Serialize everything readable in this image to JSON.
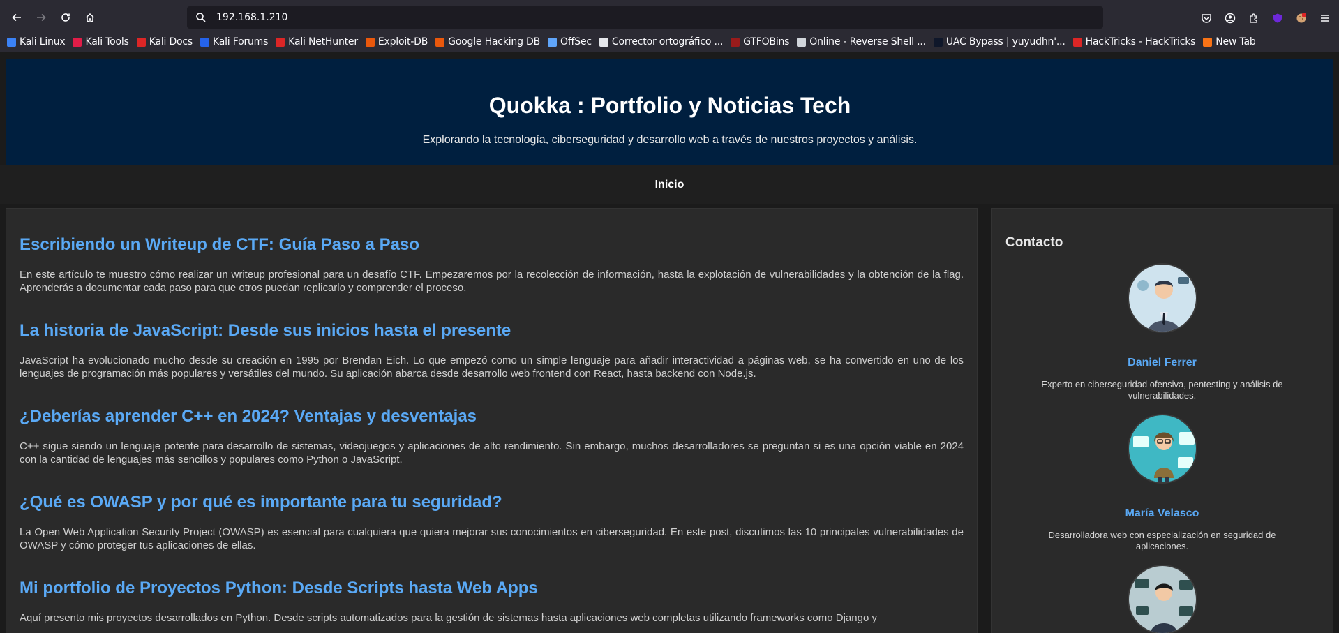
{
  "browser": {
    "url": "192.168.1.210",
    "bookmarks": [
      {
        "label": "Kali Linux",
        "color": "#3b82f6"
      },
      {
        "label": "Kali Tools",
        "color": "#e11d48"
      },
      {
        "label": "Kali Docs",
        "color": "#dc2626"
      },
      {
        "label": "Kali Forums",
        "color": "#2563eb"
      },
      {
        "label": "Kali NetHunter",
        "color": "#dc2626"
      },
      {
        "label": "Exploit-DB",
        "color": "#ea580c"
      },
      {
        "label": "Google Hacking DB",
        "color": "#ea580c"
      },
      {
        "label": "OffSec",
        "color": "#60a5fa"
      },
      {
        "label": "Corrector ortográfico ...",
        "color": "#e5e7eb"
      },
      {
        "label": "GTFOBins",
        "color": "#991b1b"
      },
      {
        "label": "Online - Reverse Shell ...",
        "color": "#d1d5db"
      },
      {
        "label": "UAC Bypass | yuyudhn'...",
        "color": "#0f172a"
      },
      {
        "label": "HackTricks - HackTricks",
        "color": "#dc2626"
      },
      {
        "label": "New Tab",
        "color": "#f97316"
      }
    ]
  },
  "site": {
    "title": "Quokka : Portfolio y Noticias Tech",
    "subtitle": "Explorando la tecnología, ciberseguridad y desarrollo web a través de nuestros proyectos y análisis.",
    "nav_home": "Inicio"
  },
  "posts": [
    {
      "title": "Escribiendo un Writeup de CTF: Guía Paso a Paso",
      "body": "En este artículo te muestro cómo realizar un writeup profesional para un desafío CTF. Empezaremos por la recolección de información, hasta la explotación de vulnerabilidades y la obtención de la flag. Aprenderás a documentar cada paso para que otros puedan replicarlo y comprender el proceso."
    },
    {
      "title": "La historia de JavaScript: Desde sus inicios hasta el presente",
      "body": "JavaScript ha evolucionado mucho desde su creación en 1995 por Brendan Eich. Lo que empezó como un simple lenguaje para añadir interactividad a páginas web, se ha convertido en uno de los lenguajes de programación más populares y versátiles del mundo. Su aplicación abarca desde desarrollo web frontend con React, hasta backend con Node.js."
    },
    {
      "title": "¿Deberías aprender C++ en 2024? Ventajas y desventajas",
      "body": "C++ sigue siendo un lenguaje potente para desarrollo de sistemas, videojuegos y aplicaciones de alto rendimiento. Sin embargo, muchos desarrolladores se preguntan si es una opción viable en 2024 con la cantidad de lenguajes más sencillos y populares como Python o JavaScript."
    },
    {
      "title": "¿Qué es OWASP y por qué es importante para tu seguridad?",
      "body": "La Open Web Application Security Project (OWASP) es esencial para cualquiera que quiera mejorar sus conocimientos en ciberseguridad. En este post, discutimos las 10 principales vulnerabilidades de OWASP y cómo proteger tus aplicaciones de ellas."
    },
    {
      "title": "Mi portfolio de Proyectos Python: Desde Scripts hasta Web Apps",
      "body": "Aquí presento mis proyectos desarrollados en Python. Desde scripts automatizados para la gestión de sistemas hasta aplicaciones web completas utilizando frameworks como Django y"
    }
  ],
  "contact": {
    "heading": "Contacto",
    "people": [
      {
        "name": "Daniel Ferrer",
        "desc": "Experto en ciberseguridad ofensiva, pentesting y análisis de vulnerabilidades."
      },
      {
        "name": "María Velasco",
        "desc": "Desarrolladora web con especialización en seguridad de aplicaciones."
      },
      {
        "name": "",
        "desc": ""
      }
    ]
  }
}
